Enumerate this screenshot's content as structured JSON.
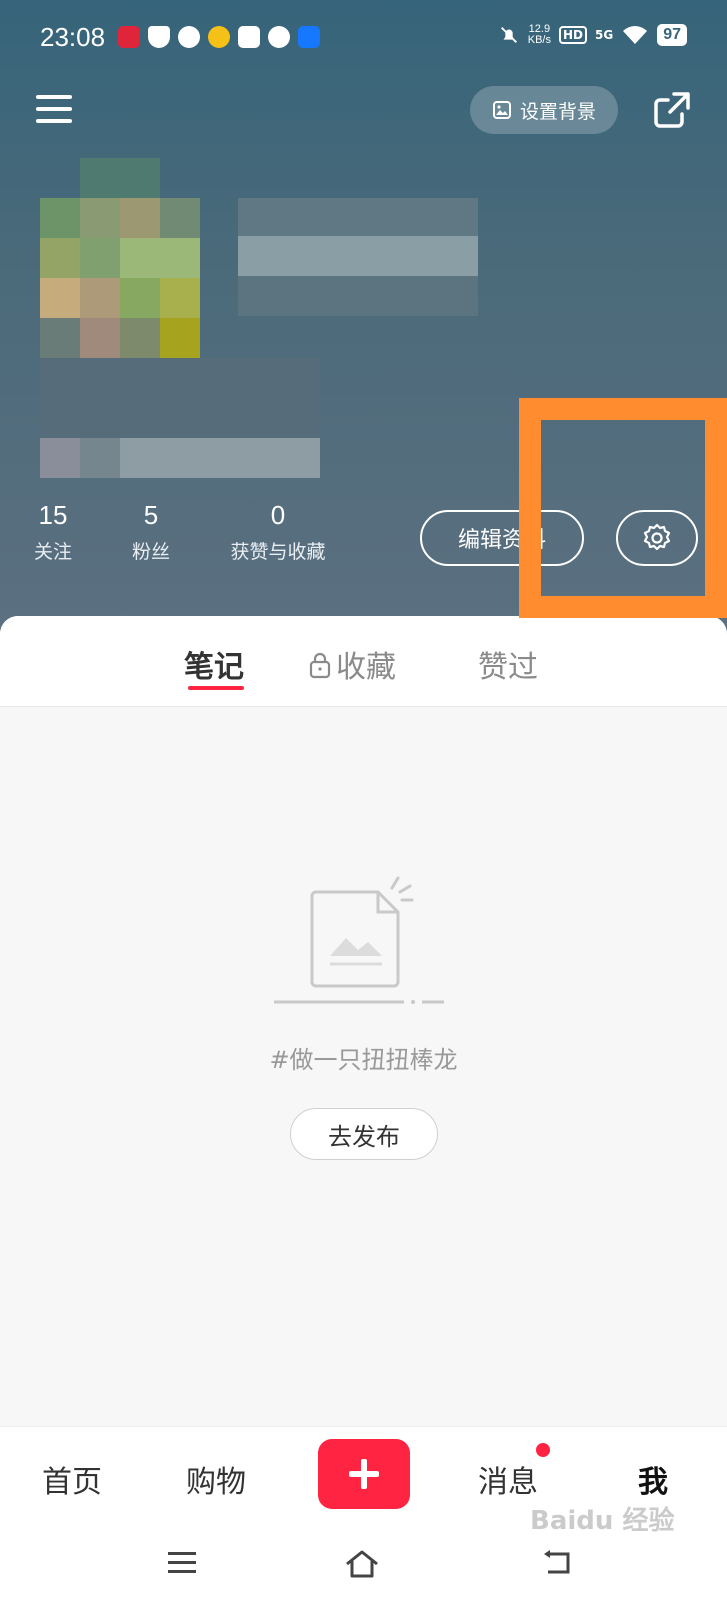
{
  "status_bar": {
    "time": "23:08",
    "net_speed": "12.9",
    "net_unit": "KB/s",
    "hd": "HD",
    "network": "5G",
    "battery": "97"
  },
  "header": {
    "set_background_label": "设置背景"
  },
  "stats": [
    {
      "count": "15",
      "label": "关注"
    },
    {
      "count": "5",
      "label": "粉丝"
    },
    {
      "count": "0",
      "label": "获赞与收藏"
    }
  ],
  "actions": {
    "edit_profile_label": "编辑资料"
  },
  "tabs": [
    {
      "label": "笔记",
      "active": true
    },
    {
      "label": "收藏",
      "locked": true
    },
    {
      "label": "赞过"
    }
  ],
  "empty_state": {
    "hint": "#做一只扭扭棒龙",
    "publish_label": "去发布"
  },
  "bottom_nav": [
    {
      "label": "首页"
    },
    {
      "label": "购物"
    },
    {
      "label": "消息",
      "badge": true
    },
    {
      "label": "我",
      "active": true
    }
  ],
  "colors": {
    "accent": "#ff2442",
    "highlight": "#ff8c2e",
    "header_bg": "#3f6878"
  },
  "watermark": "Baidu 经验"
}
